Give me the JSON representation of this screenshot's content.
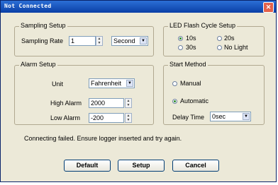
{
  "window": {
    "title": "Not Connected"
  },
  "sampling": {
    "legend": "Sampling Setup",
    "rate_label": "Sampling Rate",
    "rate_value": "1",
    "unit_value": "Second"
  },
  "led": {
    "legend": "LED Flash Cycle Setup",
    "options": [
      "10s",
      "20s",
      "30s",
      "No Light"
    ],
    "selected": "10s"
  },
  "alarm": {
    "legend": "Alarm Setup",
    "unit_label": "Unit",
    "unit_value": "Fahrenheit",
    "high_label": "High Alarm",
    "high_value": "2000",
    "low_label": "Low Alarm",
    "low_value": "-200"
  },
  "start": {
    "legend": "Start Method",
    "manual": "Manual",
    "automatic": "Automatic",
    "selected": "Automatic",
    "delay_label": "Delay Time",
    "delay_value": "0sec"
  },
  "status": "Connecting failed. Ensure logger inserted and try again.",
  "buttons": {
    "default": "Default",
    "setup": "Setup",
    "cancel": "Cancel"
  }
}
